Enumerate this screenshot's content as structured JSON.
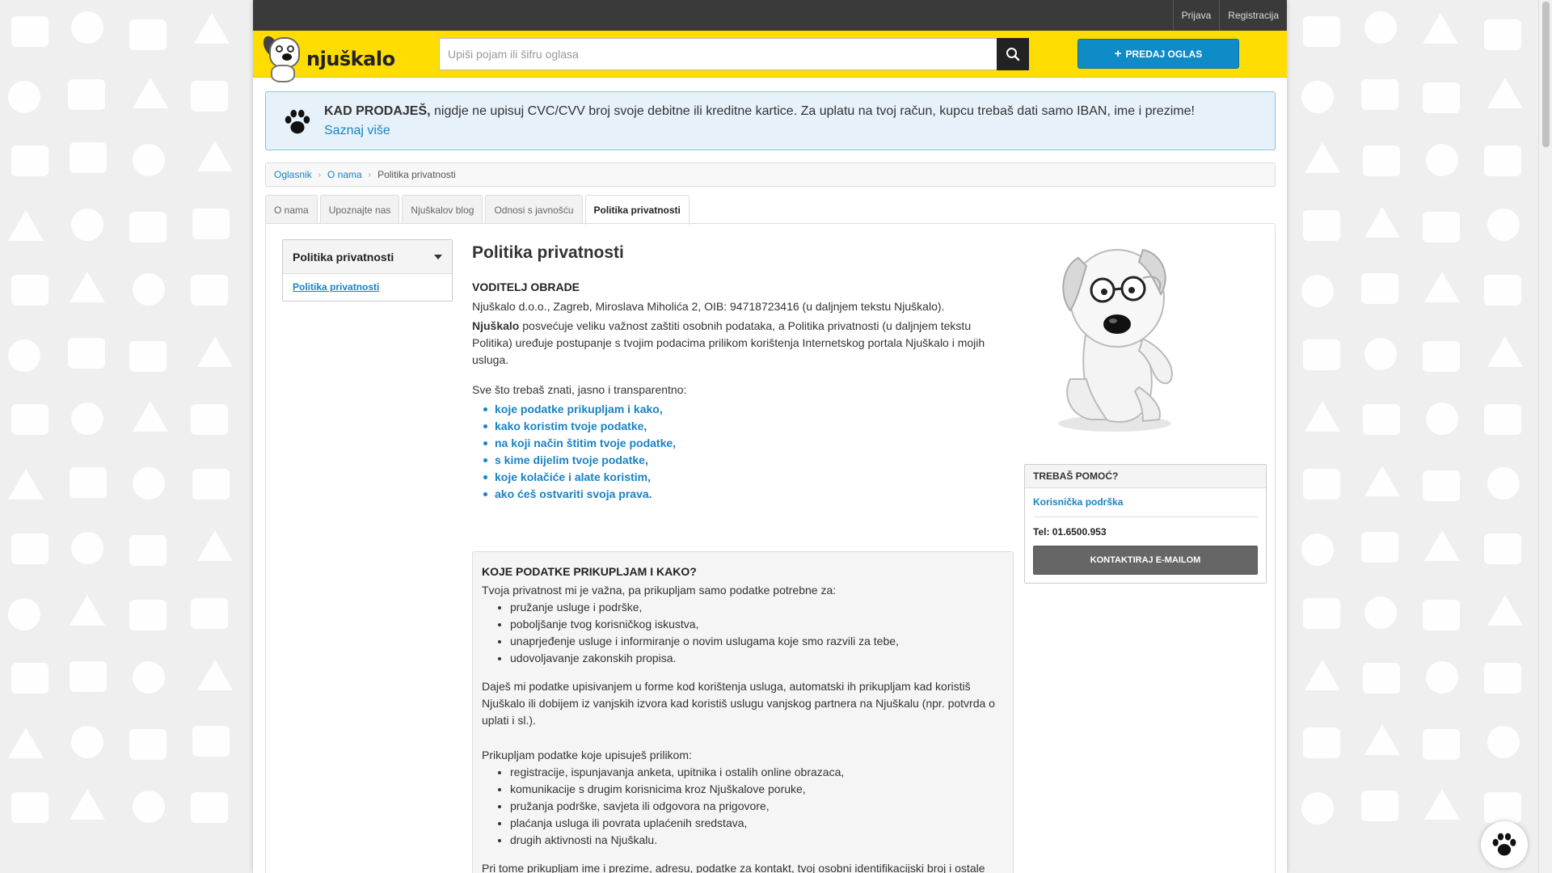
{
  "topbar": {
    "login": "Prijava",
    "register": "Registracija"
  },
  "header": {
    "logo_text": "njuškalo",
    "search_placeholder": "Upiši pojam ili šifru oglasa",
    "sell_button": "PREDAJ OGLAS"
  },
  "notice": {
    "bold": "KAD PRODAJEŠ,",
    "text": " nigdje ne upisuj CVC/CVV broj svoje debitne ili kreditne kartice. Za uplatu na tvoj račun, kupcu trebaš dati samo IBAN, ime i prezime!",
    "link": "Saznaj više"
  },
  "breadcrumb": {
    "items": [
      "Oglasnik",
      "O nama"
    ],
    "current": "Politika privatnosti"
  },
  "tabs": [
    "O nama",
    "Upoznajte nas",
    "Njuškalov blog",
    "Odnosi s javnošću",
    "Politika privatnosti"
  ],
  "sidenav": {
    "title": "Politika privatnosti",
    "item": "Politika privatnosti"
  },
  "main": {
    "title": "Politika privatnosti",
    "controller_heading": "VODITELJ OBRADE",
    "controller_text": "Njuškalo d.o.o., Zagreb, Miroslava Miholića 2, OIB: 94718723416 (u daljnjem tekstu Njuškalo).",
    "intro_bold": "Njuškalo",
    "intro_text": " posvećuje veliku važnost zaštiti osobnih podataka, a Politika privatnosti (u daljnjem tekstu Politika) uređuje postupanje s tvojim podacima prilikom korištenja Internetskog portala Njuškalo i mojih usluga.",
    "toc_intro": "Sve što trebaš znati, jasno i transparentno:",
    "toc": [
      "koje podatke prikupljam i kako,",
      "kako koristim tvoje podatke,",
      "na koji način štitim tvoje podatke,",
      "s kime dijelim tvoje podatke,",
      "koje kolačiće i alate koristim,",
      "ako ćeš ostvariti svoja prava."
    ]
  },
  "section": {
    "heading": "KOJE PODATKE PRIKUPLJAM I KAKO?",
    "intro": "Tvoja privatnost mi je važna, pa prikupljam samo podatke potrebne za:",
    "list1": [
      "pružanje usluge i podrške,",
      "poboljšanje tvog korisničkog iskustva,",
      "unaprjeđenje usluge i informiranje o novim uslugama koje smo razvili za tebe,",
      "udovoljavanje zakonskih propisa."
    ],
    "para2": "Daješ mi podatke upisivanjem u forme kod korištenja usluga, automatski ih prikupljam kad koristiš Njuškalo ili dobijem iz vanjskih izvora kad koristiš uslugu vanjskog partnera na Njuškalu (npr. potvrda o uplati i sl.).",
    "para3": "Prikupljam podatke koje upisuješ prilikom:",
    "list2": [
      "registracije, ispunjavanja anketa, upitnika i ostalih online obrazaca,",
      "komunikacije s drugim korisnicima kroz Njuškalove poruke,",
      "pružanja podrške, savjeta ili odgovora na prigovore,",
      "plaćanja usluga ili povrata uplaćenih sredstava,",
      "drugih aktivnosti na Njuškalu."
    ],
    "para4": "Pri tome prikupljam ime i prezime, adresu, podatke za kontakt, tvoj osobni identifikacijski broj i ostale"
  },
  "help": {
    "title": "TREBAŠ POMOĆ?",
    "support_link": "Korisnička podrška",
    "tel": "Tel: 01.6500.953",
    "contact_button": "KONTAKTIRAJ E-MAILOM"
  },
  "colors": {
    "brand_yellow": "#ffdd00",
    "link_blue": "#1a82c2",
    "sell_blue": "#0f8cc8"
  }
}
